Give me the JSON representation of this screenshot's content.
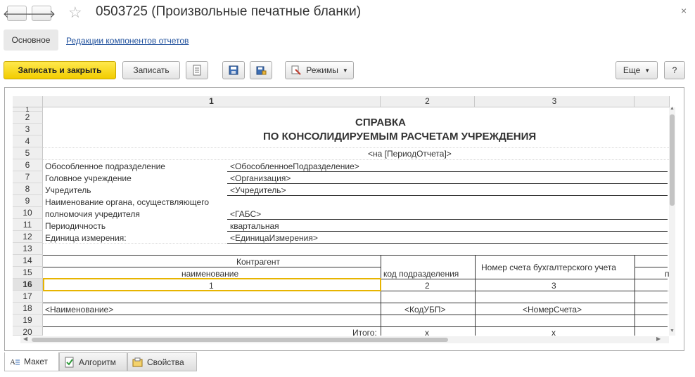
{
  "window": {
    "title": "0503725 (Произвольные печатные бланки)"
  },
  "nav": {
    "back_glyph": "🡐",
    "forward_glyph": "🡒",
    "star_glyph": "☆",
    "close_glyph": "×"
  },
  "tabs": {
    "main": "Основное",
    "link": "Редакции компонентов отчетов"
  },
  "toolbar": {
    "save_close": "Записать и закрыть",
    "save": "Записать",
    "modes": "Режимы",
    "more": "Еще",
    "help": "?"
  },
  "sheet": {
    "col_headers": [
      "1",
      "2",
      "3"
    ],
    "row_numbers": [
      "1",
      "2",
      "3",
      "4",
      "5",
      "6",
      "7",
      "8",
      "9",
      "10",
      "11",
      "12",
      "13",
      "14",
      "15",
      "16",
      "17",
      "18",
      "19",
      "20"
    ],
    "title_line1": "СПРАВКА",
    "title_line2": "ПО КОНСОЛИДИРУЕМЫМ РАСЧЕТАМ УЧРЕЖДЕНИЯ",
    "period": "<на [ПериодОтчета]>",
    "fields": [
      {
        "label": "Обособленное подразделение",
        "value": "<ОбособленноеПодразделение>"
      },
      {
        "label": "Головное учреждение",
        "value": "<Организация>"
      },
      {
        "label": "Учредитель",
        "value": "<Учредитель>"
      },
      {
        "label": "Наименование органа, осуществляющего",
        "value": ""
      },
      {
        "label": "полномочия учредителя",
        "value": "<ГАБС>"
      },
      {
        "label": "Периодичность",
        "value": "квартальная"
      },
      {
        "label": "Единица измерения:",
        "value": "<ЕдиницаИзмерения>"
      }
    ],
    "table_header": {
      "counterparty": "Контрагент",
      "name": "наименование",
      "subdiv_code": "код подразделения",
      "account_no": "Номер счета бухгалтерского учета",
      "cut_off": "п"
    },
    "col_nums": [
      "1",
      "2",
      "3"
    ],
    "row18": [
      "<Наименование>",
      "<КодУБП>",
      "<НомерСчета>"
    ],
    "row20": [
      "Итого:",
      "х",
      "х"
    ]
  },
  "bottom_tabs": {
    "layout": "Макет",
    "algorithm": "Алгоритм",
    "properties": "Свойства"
  }
}
